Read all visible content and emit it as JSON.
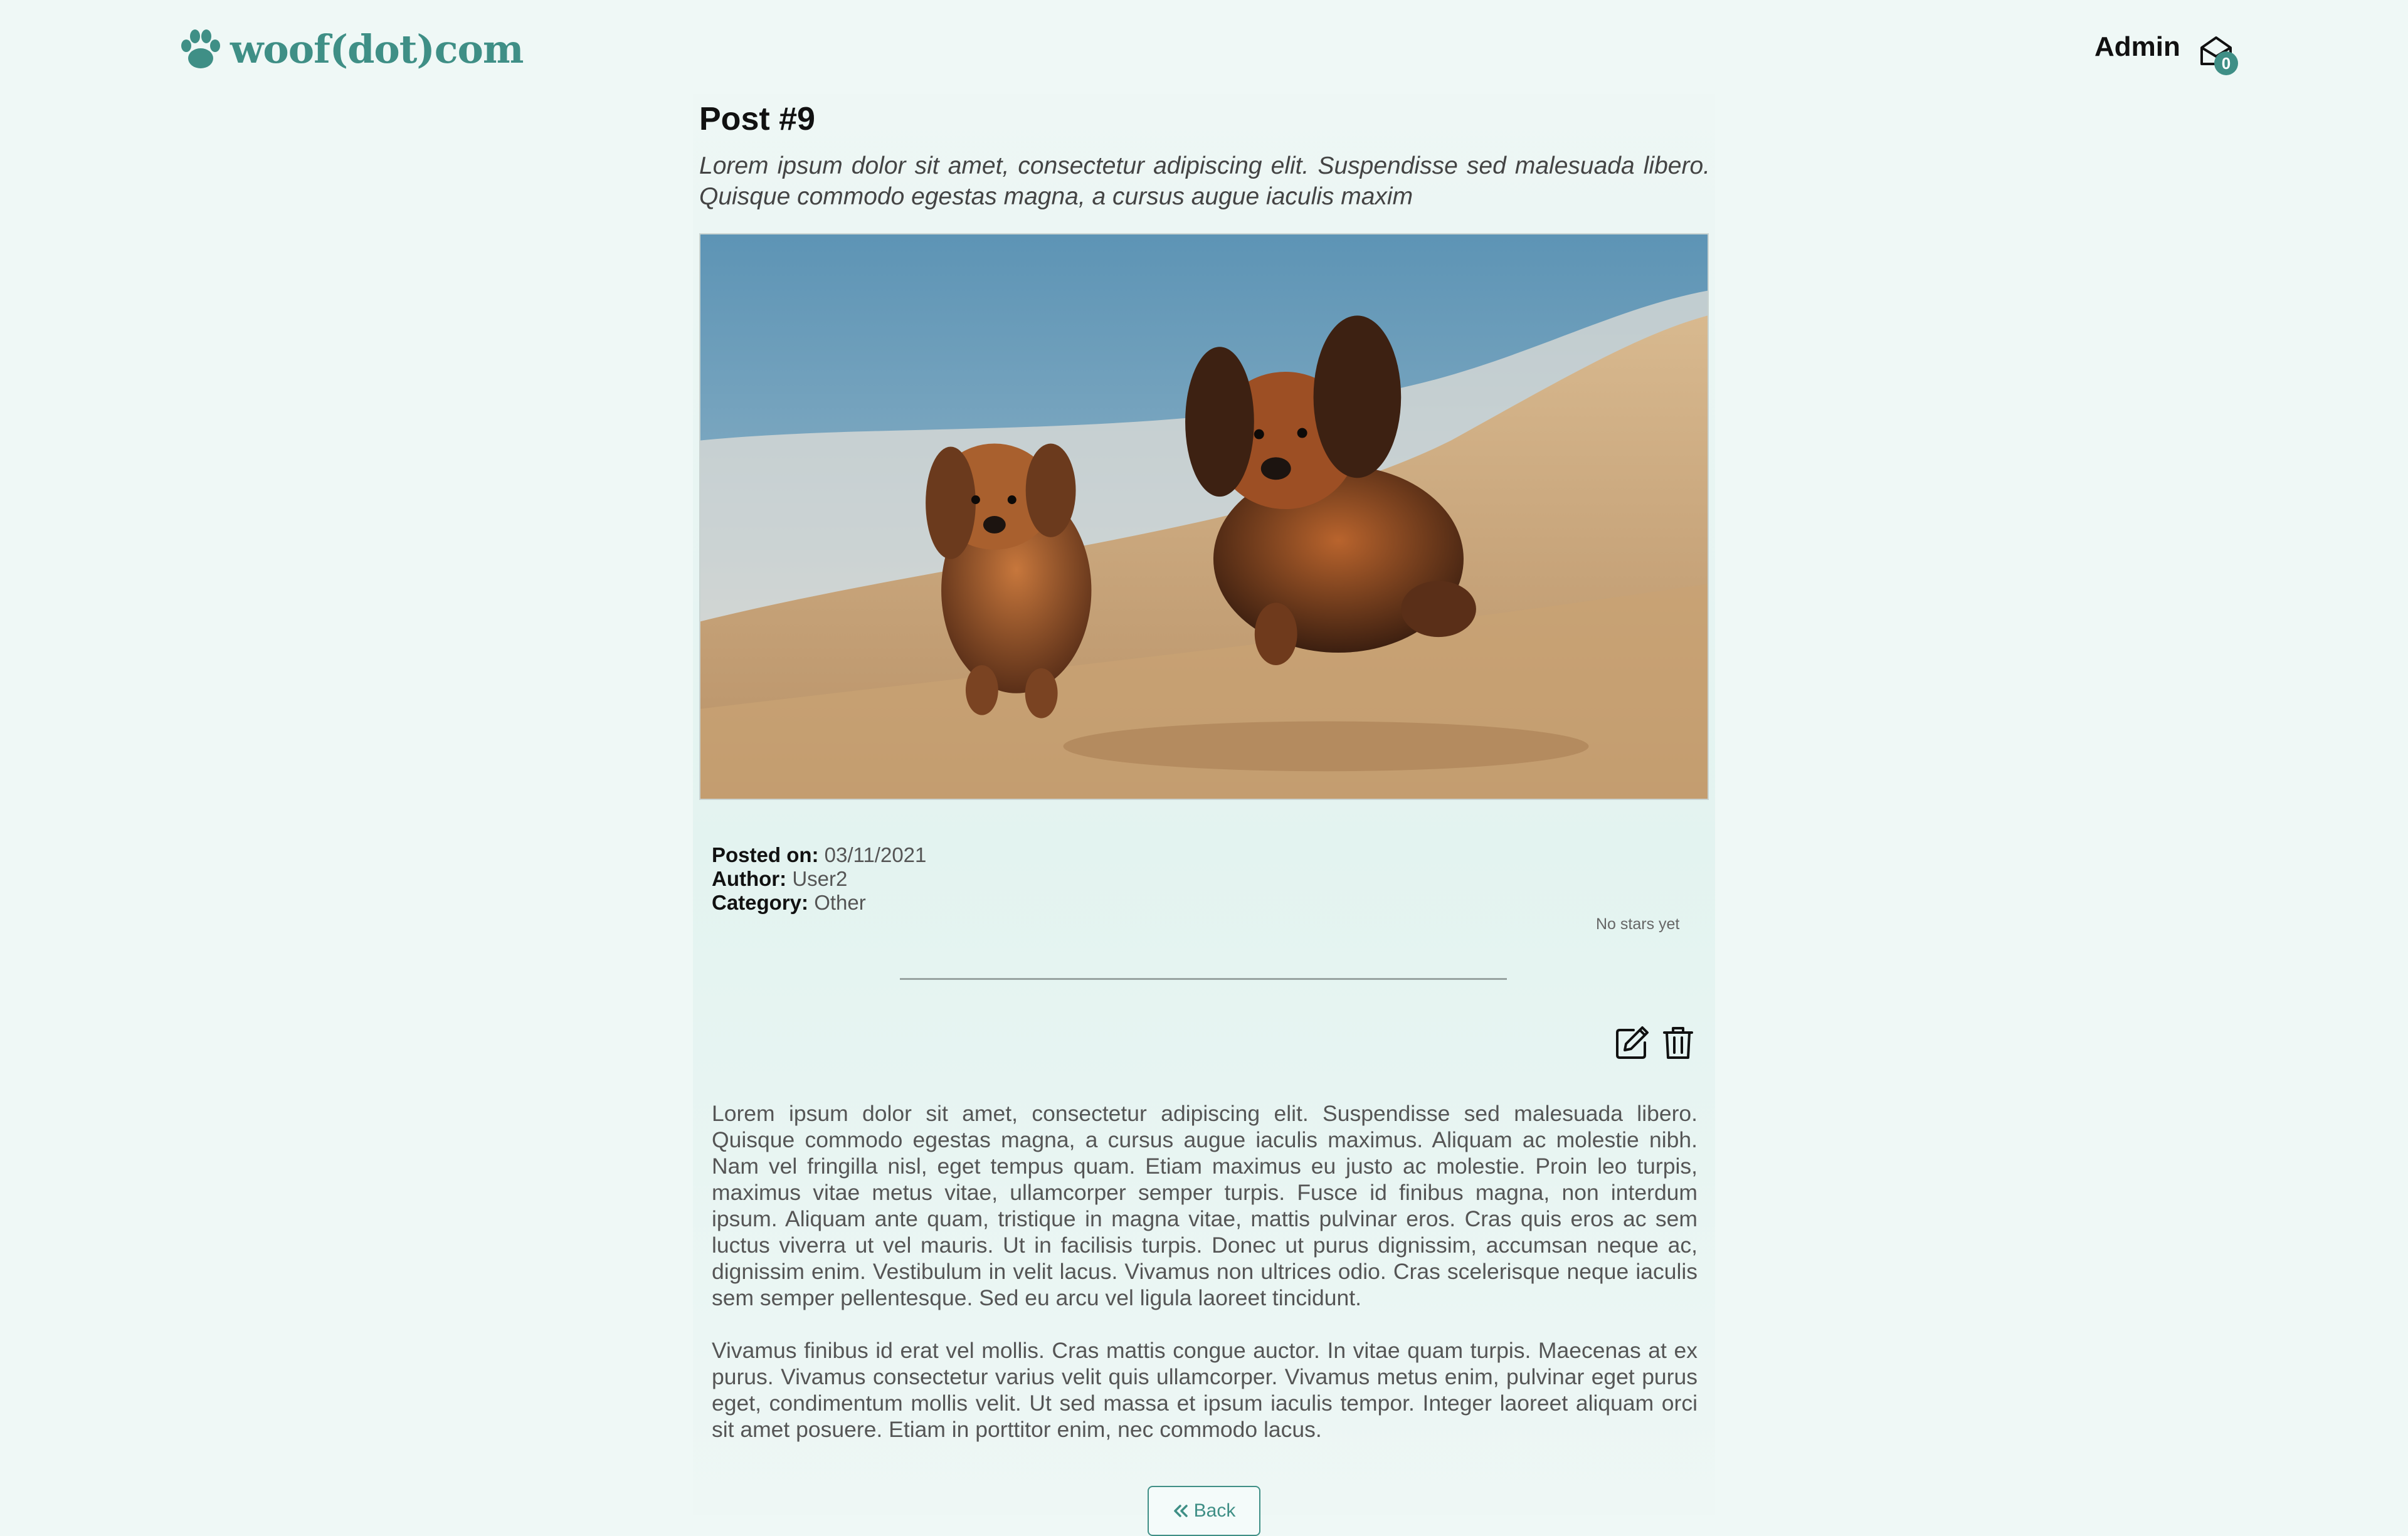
{
  "header": {
    "logo_text": "woof(dot)com",
    "user_name": "Admin",
    "mail_count": "0"
  },
  "post": {
    "title": "Post #9",
    "subtitle": "Lorem ipsum dolor sit amet, consectetur adipiscing elit. Suspendisse sed malesuada libero. Quisque commodo egestas magna, a cursus augue iaculis maxim",
    "image_subject": "two long-haired dachshunds running on a sandy beach",
    "meta": {
      "posted_label": "Posted on:",
      "posted_value": "03/11/2021",
      "author_label": "Author:",
      "author_value": "User2",
      "category_label": "Category:",
      "category_value": "Other"
    },
    "stars_text": "No stars yet",
    "body": [
      "Lorem ipsum dolor sit amet, consectetur adipiscing elit. Suspendisse sed malesuada libero. Quisque commodo egestas magna, a cursus augue iaculis maximus. Aliquam ac molestie nibh. Nam vel fringilla nisl, eget tempus quam. Etiam maximus eu justo ac molestie. Proin leo turpis, maximus vitae metus vitae, ullamcorper semper turpis. Fusce id finibus magna, non interdum ipsum. Aliquam ante quam, tristique in magna vitae, mattis pulvinar eros. Cras quis eros ac sem luctus viverra ut vel mauris. Ut in facilisis turpis. Donec ut purus dignissim, accumsan neque ac, dignissim enim. Vestibulum in velit lacus. Vivamus non ultrices odio. Cras scelerisque neque iaculis sem semper pellentesque. Sed eu arcu vel ligula laoreet tincidunt.",
      "Vivamus finibus id erat vel mollis. Cras mattis congue auctor. In vitae quam turpis. Maecenas at ex purus. Vivamus consectetur varius velit quis ullamcorper. Vivamus metus enim, pulvinar eget purus eget, condimentum mollis velit. Ut sed massa et ipsum iaculis tempor. Integer laoreet aliquam orci sit amet posuere. Etiam in porttitor enim, nec commodo lacus."
    ],
    "back_label": "Back"
  },
  "icons": {
    "logo": "paw-icon",
    "mail": "envelope-open-icon",
    "edit": "edit-icon",
    "delete": "trash-icon",
    "back": "double-chevron-left-icon"
  },
  "colors": {
    "background": "#eff8f6",
    "accent": "#3f8f86",
    "heading": "#111111",
    "body_text": "#555555"
  }
}
